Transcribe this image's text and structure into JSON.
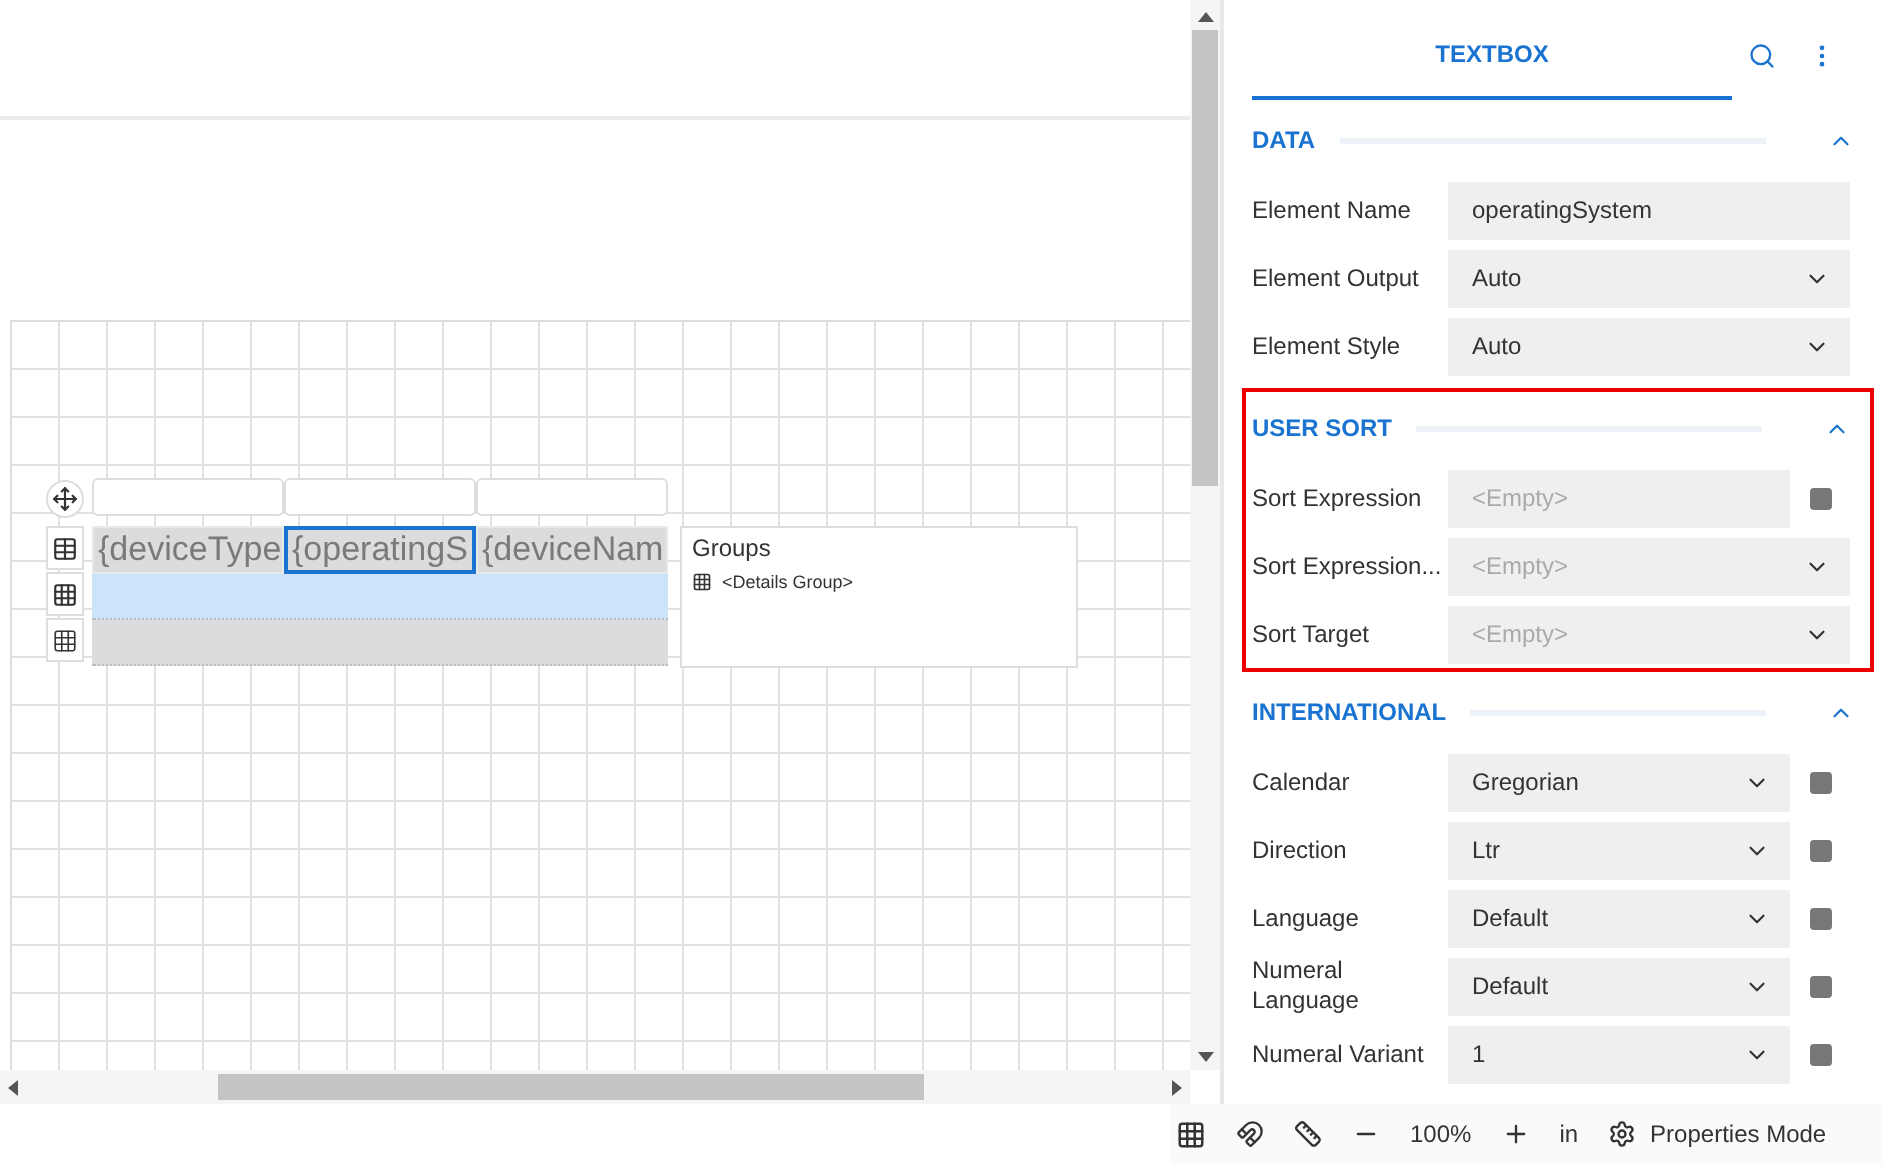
{
  "table": {
    "header_cells": [
      "",
      "",
      ""
    ],
    "detail_cells": [
      {
        "text": "{deviceType",
        "selected": false
      },
      {
        "text": "{operatingS",
        "selected": true
      },
      {
        "text": "{deviceNam",
        "selected": false
      }
    ],
    "rows": [
      {
        "kind": "detail",
        "selected": false
      },
      {
        "kind": "group",
        "selected": true
      },
      {
        "kind": "footer",
        "selected": false
      }
    ],
    "groups_title": "Groups",
    "groups": [
      "<Details Group>"
    ]
  },
  "panel": {
    "title": "TEXTBOX",
    "sections": [
      {
        "title": "DATA",
        "expanded": true,
        "highlighted": false,
        "rows": [
          {
            "label": "Element Name",
            "kind": "text",
            "value": "operatingSystem",
            "expression_button": false
          },
          {
            "label": "Element Output",
            "kind": "select",
            "value": "Auto",
            "expression_button": false
          },
          {
            "label": "Element Style",
            "kind": "select",
            "value": "Auto",
            "expression_button": false
          }
        ]
      },
      {
        "title": "USER SORT",
        "expanded": true,
        "highlighted": true,
        "rows": [
          {
            "label": "Sort Expression",
            "kind": "text",
            "placeholder": "<Empty>",
            "expression_button": true
          },
          {
            "label": "Sort Expression...",
            "kind": "select",
            "placeholder": "<Empty>",
            "expression_button": false
          },
          {
            "label": "Sort Target",
            "kind": "select",
            "placeholder": "<Empty>",
            "expression_button": false
          }
        ]
      },
      {
        "title": "INTERNATIONAL",
        "expanded": true,
        "highlighted": false,
        "rows": [
          {
            "label": "Calendar",
            "kind": "select",
            "value": "Gregorian",
            "expression_button": true
          },
          {
            "label": "Direction",
            "kind": "select",
            "value": "Ltr",
            "expression_button": true
          },
          {
            "label": "Language",
            "kind": "select",
            "value": "Default",
            "expression_button": true
          },
          {
            "label": "Numeral Language",
            "kind": "select",
            "value": "Default",
            "expression_button": true
          },
          {
            "label": "Numeral Variant",
            "kind": "select",
            "value": "1",
            "expression_button": true
          }
        ]
      }
    ]
  },
  "toolbar": {
    "zoom": "100%",
    "unit": "in",
    "mode": "Properties Mode"
  }
}
